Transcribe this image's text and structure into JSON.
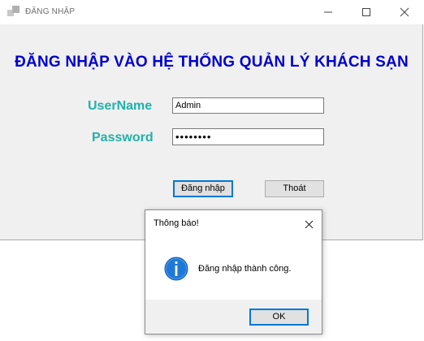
{
  "window": {
    "title": "ĐĂNG NHẬP",
    "icon": "app-window-icon",
    "controls": [
      "minimize-icon",
      "maximize-icon",
      "close-icon"
    ]
  },
  "form": {
    "heading": "ĐĂNG NHẬP VÀO HỆ THỐNG QUẢN LÝ KHÁCH SẠN",
    "username_label": "UserName",
    "username_value": "Admin",
    "password_label": "Password",
    "password_value": "••••••••",
    "login_button": "Đăng nhập",
    "exit_button": "Thoát"
  },
  "dialog": {
    "title": "Thông báo!",
    "icon": "info-icon",
    "message": "Đăng nhập thành công.",
    "ok_button": "OK"
  },
  "colors": {
    "heading": "#0000cd",
    "label": "#20b2aa",
    "focus_border": "#0078d7",
    "info_icon": "#1e78d7"
  }
}
